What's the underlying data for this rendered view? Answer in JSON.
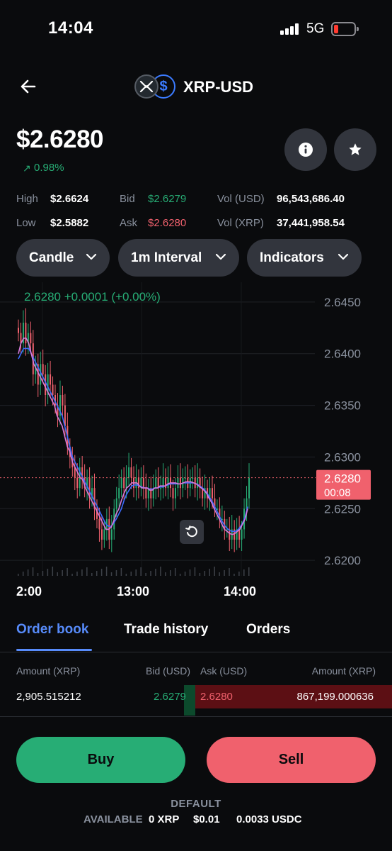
{
  "status_bar": {
    "time": "14:04",
    "network": "5G"
  },
  "header": {
    "title": "XRP-USD",
    "quote_symbol": "$"
  },
  "price": {
    "value": "$2.6280",
    "change": "0.98%",
    "change_arrow": "↗"
  },
  "stats": {
    "high_label": "High",
    "high_value": "$2.6624",
    "low_label": "Low",
    "low_value": "$2.5882",
    "bid_label": "Bid",
    "bid_value": "$2.6279",
    "ask_label": "Ask",
    "ask_value": "$2.6280",
    "vol_usd_label": "Vol (USD)",
    "vol_usd_value": "96,543,686.40",
    "vol_xrp_label": "Vol (XRP)",
    "vol_xrp_value": "37,441,958.54"
  },
  "controls": {
    "chart_type": "Candle",
    "interval": "1m Interval",
    "indicators": "Indicators"
  },
  "chart_data": {
    "type": "candlestick",
    "legend": "2.6280  +0.0001 (+0.00%)",
    "x_tick_labels": [
      "2:00",
      "13:00",
      "14:00"
    ],
    "y_tick_labels": [
      "2.6450",
      "2.6400",
      "2.6350",
      "2.6300",
      "2.6250",
      "2.6200"
    ],
    "y_ticks": [
      2.645,
      2.64,
      2.635,
      2.63,
      2.625,
      2.62
    ],
    "ylim": [
      2.6185,
      2.6465
    ],
    "current_price": 2.628,
    "current_price_label": "2.6280",
    "countdown": "00:08",
    "close": [
      2.642,
      2.641,
      2.643,
      2.641,
      2.642,
      2.641,
      2.638,
      2.639,
      2.637,
      2.639,
      2.638,
      2.636,
      2.638,
      2.637,
      2.636,
      2.635,
      2.634,
      2.636,
      2.635,
      2.633,
      2.631,
      2.63,
      2.629,
      2.628,
      2.627,
      2.629,
      2.628,
      2.627,
      2.628,
      2.626,
      2.627,
      2.625,
      2.624,
      2.623,
      2.622,
      2.623,
      2.624,
      2.622,
      2.623,
      2.625,
      2.626,
      2.627,
      2.628,
      2.627,
      2.628,
      2.629,
      2.628,
      2.627,
      2.628,
      2.627,
      2.628,
      2.627,
      2.626,
      2.627,
      2.626,
      2.627,
      2.628,
      2.627,
      2.627,
      2.628,
      2.627,
      2.628,
      2.627,
      2.626,
      2.627,
      2.628,
      2.627,
      2.628,
      2.628,
      2.627,
      2.628,
      2.628,
      2.627,
      2.628,
      2.627,
      2.626,
      2.627,
      2.626,
      2.627,
      2.626,
      2.625,
      2.625,
      2.624,
      2.624,
      2.623,
      2.623,
      2.622,
      2.623,
      2.622,
      2.623,
      2.622,
      2.623,
      2.625,
      2.626,
      2.628
    ],
    "ma_fast": [
      2.64,
      2.641,
      2.6415,
      2.6415,
      2.641,
      2.64,
      2.639,
      2.6385,
      2.638,
      2.6375,
      2.637,
      2.6365,
      2.636,
      2.6355,
      2.635,
      2.634,
      2.6335,
      2.633,
      2.632,
      2.631,
      2.6305,
      2.6295,
      2.629,
      2.6285,
      2.628,
      2.6278,
      2.627,
      2.6265,
      2.626,
      2.6255,
      2.625,
      2.6245,
      2.624,
      2.6235,
      2.623,
      2.623,
      2.6232,
      2.6238,
      2.6245,
      2.625,
      2.6258,
      2.6265,
      2.627,
      2.6272,
      2.6275,
      2.6275,
      2.6275,
      2.6272,
      2.627,
      2.627,
      2.627,
      2.6268,
      2.6268,
      2.627,
      2.627,
      2.6272,
      2.6272,
      2.6272,
      2.6274,
      2.6275,
      2.6275,
      2.6275,
      2.6274,
      2.6274,
      2.6275,
      2.6276,
      2.6276,
      2.6276,
      2.6275,
      2.6274,
      2.6272,
      2.627,
      2.6268,
      2.6265,
      2.626,
      2.6256,
      2.625,
      2.6245,
      2.624,
      2.6235,
      2.623,
      2.6228,
      2.6226,
      2.6225,
      2.6226,
      2.6228,
      2.623,
      2.6235,
      2.624,
      2.625
    ],
    "ma_slow": [
      2.6395,
      2.64,
      2.6405,
      2.6405,
      2.6405,
      2.64,
      2.6395,
      2.639,
      2.6385,
      2.638,
      2.6375,
      2.637,
      2.6365,
      2.636,
      2.6355,
      2.635,
      2.6345,
      2.634,
      2.633,
      2.632,
      2.631,
      2.63,
      2.6295,
      2.629,
      2.6285,
      2.628,
      2.6275,
      2.627,
      2.6265,
      2.626,
      2.6255,
      2.625,
      2.6245,
      2.624,
      2.6235,
      2.6233,
      2.6233,
      2.6236,
      2.624,
      2.6245,
      2.625,
      2.6258,
      2.6264,
      2.6268,
      2.6272,
      2.6273,
      2.6273,
      2.6272,
      2.6271,
      2.627,
      2.627,
      2.6269,
      2.6269,
      2.627,
      2.627,
      2.6271,
      2.6271,
      2.6272,
      2.6273,
      2.6274,
      2.6274,
      2.6274,
      2.6274,
      2.6274,
      2.6275,
      2.6275,
      2.6275,
      2.6275,
      2.6275,
      2.6274,
      2.6273,
      2.6271,
      2.6269,
      2.6266,
      2.6262,
      2.6258,
      2.6253,
      2.6248,
      2.6243,
      2.6238,
      2.6234,
      2.6231,
      2.6229,
      2.6228,
      2.6228,
      2.6229,
      2.6232,
      2.6236,
      2.6242,
      2.6252
    ]
  },
  "tabs": [
    "Order book",
    "Trade history",
    "Orders"
  ],
  "order_book": {
    "headers": [
      "Amount (XRP)",
      "Bid (USD)",
      "Ask (USD)",
      "Amount (XRP)"
    ],
    "row": {
      "bid_amount": "2,905.515212",
      "bid": "2.6279",
      "ask": "2.6280",
      "ask_amount": "867,199.000636"
    }
  },
  "actions": {
    "buy": "Buy",
    "sell": "Sell"
  },
  "footer": {
    "portfolio": "DEFAULT",
    "available_label": "AVAILABLE",
    "xrp": "0 XRP",
    "usd": "$0.01",
    "usdc": "0.0033 USDC"
  },
  "colors": {
    "green": "#27ad75",
    "red": "#f0616d",
    "blue": "#578bfa",
    "ma_blue": "#3b6cff",
    "ma_pink": "#d77ad9"
  }
}
